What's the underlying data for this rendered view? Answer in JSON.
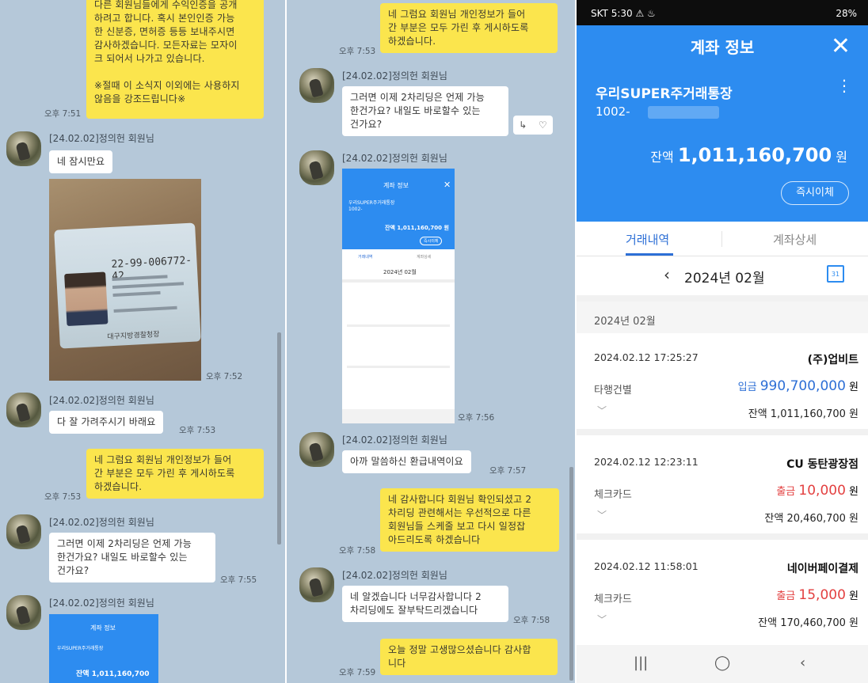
{
  "chat_left": {
    "msg_top": "다른 회원님들에게 수익인증을 공개\n하려고 합니다. 혹시 본인인증 가능\n한 신분증, 면허증 등등 보내주시면\n감사하겠습니다. 모든자료는 모자이\n크 되어서 나가고 있습니다.\n\n※절때 이 소식지 이외에는 사용하지\n않음을 강조드립니다※",
    "t1": "오후 7:51",
    "sender1": "[24.02.02]정의헌 회원님",
    "msg_wait": "네 잠시만요",
    "t2": "오후 7:52",
    "sender2": "[24.02.02]정의헌 회원님",
    "msg_cover": "다 잘 가려주시기 바래요",
    "t3": "오후 7:53",
    "msg_reply": "네 그럼요 회원님 개인정보가 들어\n간 부분은 모두 가린 후 게시하도록\n하겠습니다.",
    "t4": "오후 7:53",
    "sender3": "[24.02.02]정의헌 회원님",
    "msg_question": "그러면 이제 2차리딩은 언제 가능\n한건가요? 내일도 바로할수 있는\n건가요?",
    "t5": "오후 7:55",
    "sender4": "[24.02.02]정의헌 회원님",
    "id_card_number": "22-99-006772-42",
    "id_card_issuer": "대구지방경찰청장",
    "mini_title": "계좌 정보",
    "mini_account": "우리SUPER주거래통장",
    "mini_balance": "잔액 1,011,160,700"
  },
  "chat_right": {
    "msg_reply": "네 그럼요 회원님 개인정보가 들어\n간 부분은 모두 가린 후 게시하도록\n하겠습니다.",
    "t1": "오후 7:53",
    "sender1": "[24.02.02]정의헌 회원님",
    "msg_question": "그러면 이제 2차리딩은 언제 가능\n한건가요? 내일도 바로할수 있는\n건가요?",
    "sender2": "[24.02.02]정의헌 회원님",
    "t2": "오후 7:56",
    "sender3": "[24.02.02]정의헌 회원님",
    "msg_refund": "아까 말씀하신 환급내역이요",
    "t3": "오후 7:57",
    "msg_thanks": "네 감사합니다 회원님 확인되셨고 2\n차리딩 관련해서는 우선적으로 다른\n회원님들 스케줄 보고 다시 일정잡\n아드리도록 하겠습니다",
    "t4": "오후 7:58",
    "sender4": "[24.02.02]정의헌 회원님",
    "msg_ok": "네 알겠습니다 너무감사합니다 2\n차리딩에도 잘부탁드리겠습니다",
    "t5": "오후 7:58",
    "msg_final": "오늘 정말 고생많으셨습니다 감사합\n니다",
    "t6": "오후 7:59",
    "mini_title": "계좌 정보",
    "mini_account": "우리SUPER주거래통장",
    "mini_acct_num": "1002-",
    "mini_balance": "잔액 1,011,160,700 원",
    "mini_transfer": "즉시이체",
    "mini_tab1": "거래내역",
    "mini_tab2": "계좌상세",
    "mini_month": "2024년 02월"
  },
  "bank": {
    "status_left": "SKT 5:30 ⚠ ♨",
    "status_right": "28%",
    "title": "계좌 정보",
    "account_name": "우리SUPER주거래통장",
    "account_prefix": "1002-",
    "balance_label": "잔액",
    "balance_value": "1,011,160,700",
    "balance_unit": "원",
    "transfer_button": "즉시이체",
    "tab_history": "거래내역",
    "tab_detail": "계좌상세",
    "month": "2024년 02월",
    "calendar_day": "31",
    "section_label": "2024년 02월",
    "transactions": [
      {
        "datetime": "2024.02.12 17:25:27",
        "merchant": "(주)업비트",
        "type": "타행건별",
        "direction": "입금",
        "amount": "990,700,000",
        "unit": "원",
        "balance": "잔액 1,011,160,700 원"
      },
      {
        "datetime": "2024.02.12 12:23:11",
        "merchant": "CU 동탄광장점",
        "type": "체크카드",
        "direction": "출금",
        "amount": "10,000",
        "unit": "원",
        "balance": "잔액 20,460,700 원"
      },
      {
        "datetime": "2024.02.12 11:58:01",
        "merchant": "네이버페이결제",
        "type": "체크카드",
        "direction": "출금",
        "amount": "15,000",
        "unit": "원",
        "balance": "잔액 170,460,700 원"
      }
    ],
    "colors": {
      "primary": "#2d8cf0",
      "deposit": "#2d6fd6",
      "withdraw": "#e34040"
    }
  }
}
